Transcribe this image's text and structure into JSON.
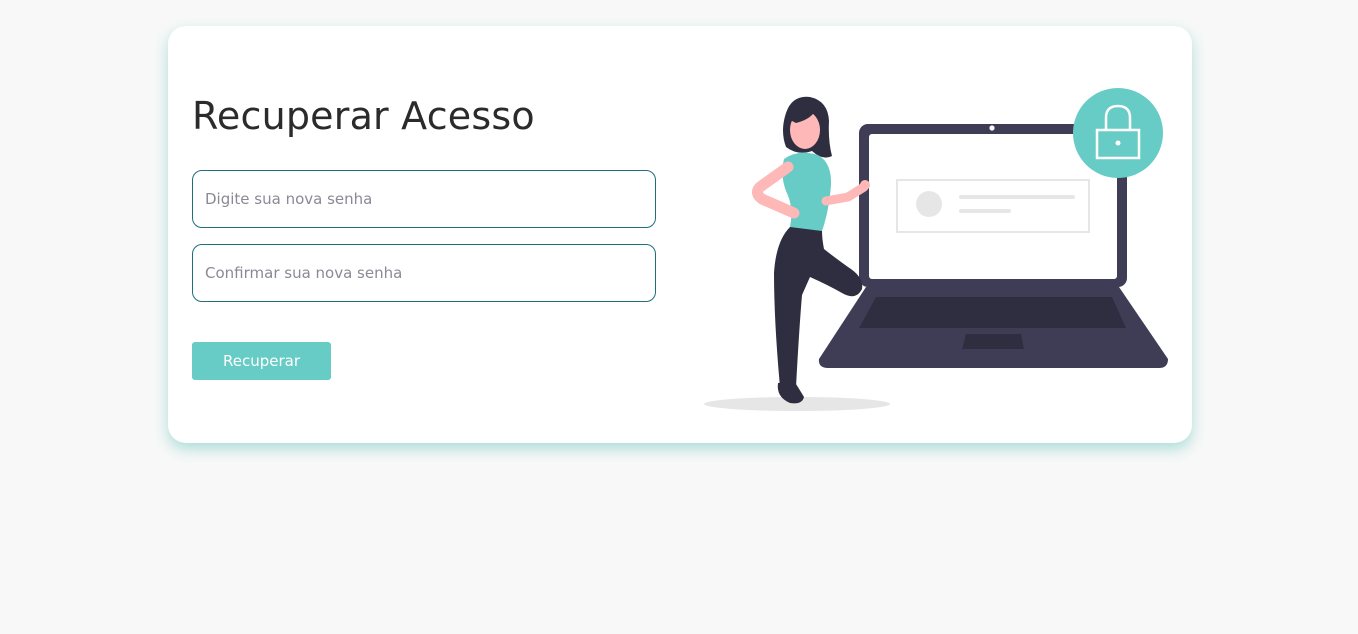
{
  "form": {
    "title": "Recuperar Acesso",
    "new_password_placeholder": "Digite sua nova senha",
    "confirm_password_placeholder": "Confirmar sua nova senha",
    "submit_label": "Recuperar"
  },
  "illustration": {
    "icon": "padlock-icon",
    "description_icons": [
      "person-figure",
      "laptop",
      "padlock-icon"
    ]
  },
  "colors": {
    "background": "#f8f8f8",
    "card": "#ffffff",
    "accent": "#67ccc5",
    "input_border": "#1f6f78",
    "title": "#2b2b2b",
    "laptop": "#3f3d56"
  }
}
